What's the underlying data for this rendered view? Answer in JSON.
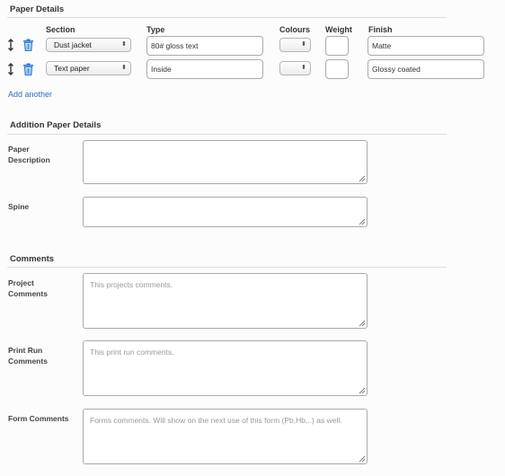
{
  "paper_details": {
    "title": "Paper Details",
    "columns": {
      "section": "Section",
      "type": "Type",
      "colours": "Colours",
      "weight": "Weight",
      "finish": "Finish"
    },
    "rows": [
      {
        "section": "Dust jacket",
        "type": "80# gloss text",
        "colours": "",
        "weight": "",
        "finish": "Matte"
      },
      {
        "section": "Text paper",
        "type": "Inside",
        "colours": "",
        "weight": "",
        "finish": "Glossy coated"
      }
    ],
    "add_link": "Add another"
  },
  "addition_details": {
    "title": "Addition Paper Details",
    "paper_description_label": "Paper Description",
    "spine_label": "Spine"
  },
  "comments": {
    "title": "Comments",
    "project_label": "Project Comments",
    "project_placeholder": "This projects comments.",
    "print_run_label": "Print Run Comments",
    "print_run_placeholder": "This print run comments.",
    "form_label": "Form Comments",
    "form_placeholder": "Forms comments. Will show on the next use of this form (Pb,Hb,..) as well."
  },
  "colors": {
    "link": "#2a6ebb",
    "trash": "#2a7fd4"
  }
}
